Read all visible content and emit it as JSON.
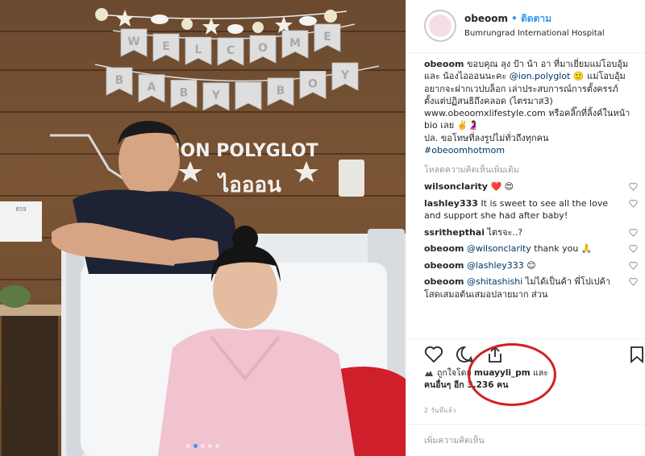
{
  "post": {
    "username": "obeoom",
    "separator": "•",
    "follow_label": "ติดตาม",
    "location": "Bumrungrad International Hospital"
  },
  "photo": {
    "banner_row1": [
      "W",
      "E",
      "L",
      "C",
      "O",
      "M",
      "E"
    ],
    "banner_row2": [
      "B",
      "A",
      "B",
      "Y",
      "",
      "B",
      "O",
      "Y"
    ],
    "sign_line1": "ION POLYGLOT",
    "sign_line2": "ไอออน",
    "room_label": "659",
    "carousel_dots": 5,
    "active_dot": 1
  },
  "caption": {
    "username": "obeoom",
    "part1": "ขอบคุณ ลุง ป้า น้า อา ที่มาเยี่ยมแม่โอบอุ้มและ น้องไอออนนะคะ ",
    "mention": "@ion.polyglot",
    "part2": " 🙂 แม่โอบอุ้มอยากจะฝากเวปบล็อก เล่าประสบการณ์การตั้งครรภ์ ตั้งแต่ปฏิสนธิถึงคลอด (ไตรมาส3) www.obeoomxlifestyle.com หรือคลิ๊กที่ลิ้งค์ในหน้า bio เลย ✌️🤰",
    "part3": "ปล. ขอโทษที่ลงรูปไม่ทั่วถึงทุกคน ",
    "hashtag": "#obeoomhotmom"
  },
  "load_more_label": "โหลดความคิดเห็นเพิ่มเติม",
  "comments": [
    {
      "user": "wilsonclarity",
      "text": " ❤️ 😍"
    },
    {
      "user": "lashley333",
      "text": " It is sweet to see all the love and support she had after baby!"
    },
    {
      "user": "ssrithepthai",
      "text": " ไตรจะ..?"
    },
    {
      "user": "obeoom",
      "mention": "@wilsonclarity",
      "text": " thank you 🙏"
    },
    {
      "user": "obeoom",
      "mention": "@lashley333",
      "text": " 😊"
    },
    {
      "user": "obeoom",
      "mention": "@shitashishi",
      "text": " ไม่ได้เป็นค้า พี่โปเปค้าโสดเสมอต้นเสมอปลายมาก ส่วน"
    }
  ],
  "likes": {
    "prefix": "ถูกใจโดย ",
    "user": "muayyli_pm",
    "middle": " และ",
    "others_prefix": "คนอื่นๆ อีก ",
    "count": "3,236",
    "unit": " คน"
  },
  "timestamp": "2 วันที่แล้ว",
  "add_comment_placeholder": "เพิ่มความคิดเห็น",
  "icons": {
    "like": "heart-icon",
    "comment": "speech-bubble-icon",
    "share": "share-icon",
    "save": "bookmark-icon"
  },
  "colors": {
    "link": "#003569",
    "follow": "#3897f0",
    "highlight_circle": "#d31f26"
  }
}
